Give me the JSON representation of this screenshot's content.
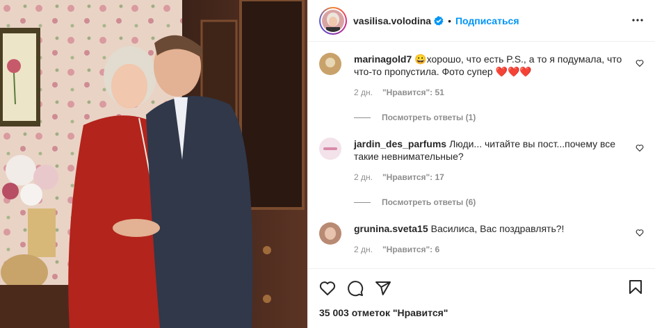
{
  "header": {
    "username": "vasilisa.volodina",
    "follow_label": "Подписаться",
    "separator": "•"
  },
  "comments": [
    {
      "user": "marinagold7",
      "text": "😀хорошо, что есть P.S., а то я подумала, что что-то пропустила. Фото супер ❤️❤️❤️",
      "time": "2 дн.",
      "likes": "\"Нравится\": 51",
      "replies": "Посмотреть ответы (1)",
      "avatar_color": "#c9a26b"
    },
    {
      "user": "jardin_des_parfums",
      "text": "Люди... читайте вы пост...почему все такие невнимательные?",
      "time": "2 дн.",
      "likes": "\"Нравится\": 17",
      "replies": "Посмотреть ответы (6)",
      "avatar_color": "#f3e2ea"
    },
    {
      "user": "grunina.sveta15",
      "text": "Василиса, Вас поздравлять?!",
      "time": "2 дн.",
      "likes": "\"Нравится\": 6",
      "replies": "",
      "avatar_color": "#b98a73"
    }
  ],
  "footer": {
    "likes_text": "35 003 отметок \"Нравится\""
  },
  "icons": {
    "verified": "verified-badge-icon",
    "more": "more-options-icon",
    "like": "heart-icon",
    "comment": "comment-icon",
    "share": "share-icon",
    "save": "bookmark-icon"
  },
  "colors": {
    "accent": "#0095f6",
    "muted": "#8e8e8e",
    "text": "#262626",
    "heart": "#ed4956"
  }
}
